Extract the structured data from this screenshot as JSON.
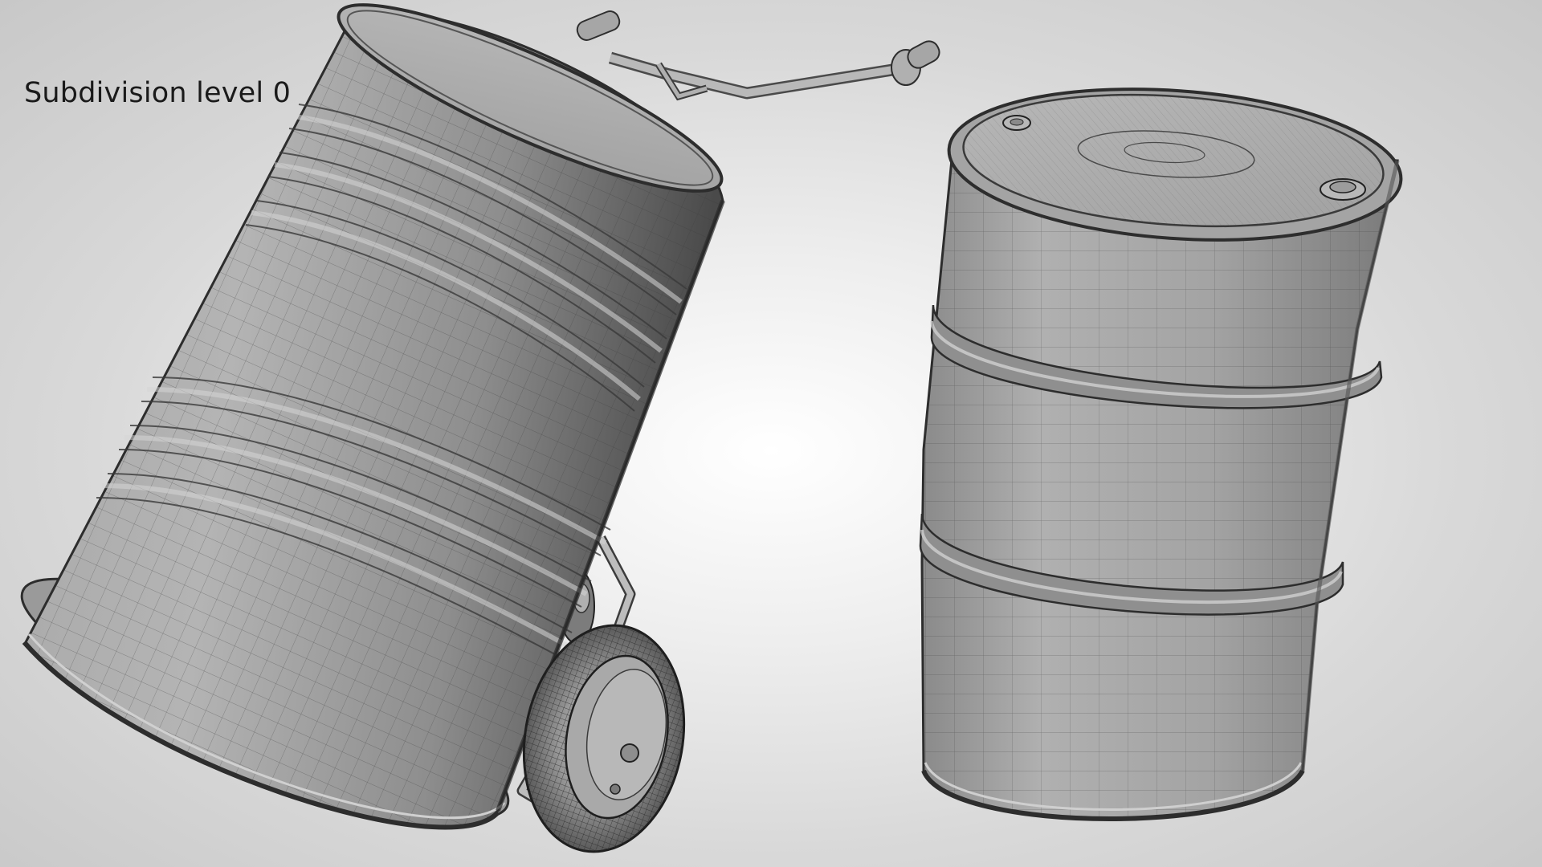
{
  "viewport": {
    "caption": "Subdivision level 0"
  },
  "scene": {
    "objects": [
      {
        "name": "hand truck with barrel",
        "wireframe": true
      },
      {
        "name": "standing barrel",
        "wireframe": true
      }
    ],
    "colors": {
      "background_center": "#ffffff",
      "background_edge": "#c8c8c8",
      "model_gray": "#9a9a9a",
      "wire": "#3a3a3a"
    }
  }
}
